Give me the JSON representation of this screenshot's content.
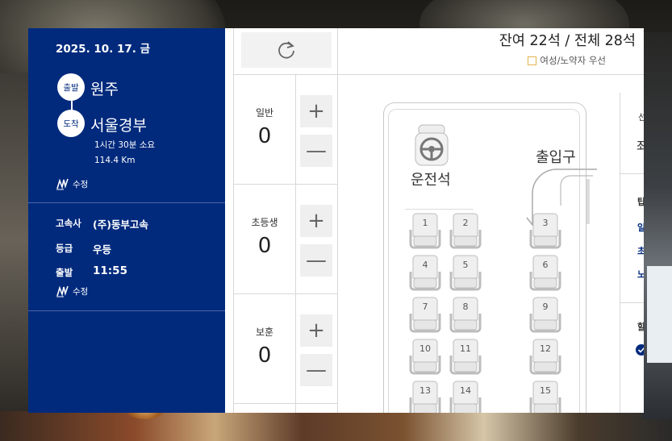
{
  "trip": {
    "date": "2025. 10. 17. 금",
    "depart_tag": "출발",
    "depart_city": "원주",
    "arrive_tag": "도착",
    "arrive_city": "서울경부",
    "duration": "1시간 30분 소요",
    "distance": "114.4 Km",
    "edit_label": "수정"
  },
  "bus_info": {
    "company_label": "고속사",
    "company": "(주)동부고속",
    "grade_label": "등급",
    "grade": "우등",
    "depart_label": "출발",
    "depart_time": "11:55",
    "edit_label": "수정"
  },
  "passengers": [
    {
      "label": "일반",
      "count": "0"
    },
    {
      "label": "초등생",
      "count": "0"
    },
    {
      "label": "보훈",
      "count": "0"
    }
  ],
  "buttons": {
    "plus": "+",
    "minus": "—"
  },
  "seats_summary": "잔여 22석 / 전체 28석",
  "legend": "여성/노약자 우선",
  "bus_map": {
    "driver_label": "운전석",
    "door_label": "출입구",
    "seat_numbers": [
      "1",
      "2",
      "3",
      "4",
      "5",
      "6",
      "7",
      "8",
      "9",
      "10",
      "11",
      "12",
      "13",
      "14",
      "15"
    ]
  },
  "right_panel_fragments": [
    "선",
    "좌",
    "탑",
    "일",
    "초",
    "노",
    "할"
  ],
  "colors": {
    "navy": "#012a7d",
    "legend_border": "#e2b34c"
  }
}
